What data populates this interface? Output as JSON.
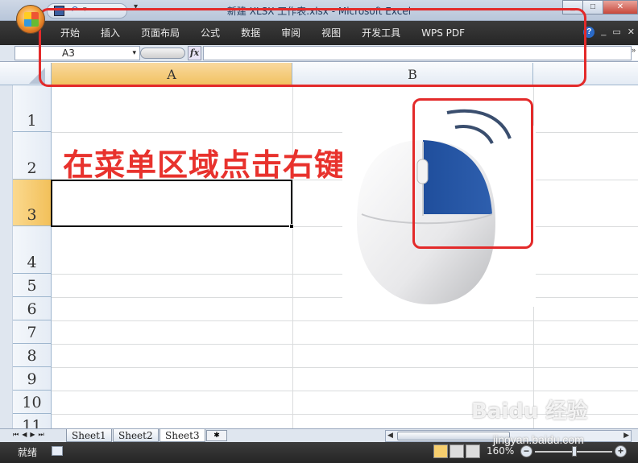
{
  "window": {
    "title": "新建 XLSX 工作表.xlsx - Microsoft Excel",
    "controls": [
      "_",
      "□",
      "✕"
    ]
  },
  "qat": {
    "undo": "↶",
    "dropdown": "▾",
    "more": "▾"
  },
  "ribbon": {
    "tabs": [
      "开始",
      "插入",
      "页面布局",
      "公式",
      "数据",
      "审阅",
      "视图",
      "开发工具",
      "WPS PDF"
    ],
    "right": {
      "help": "?",
      "min": "_",
      "restore": "▭",
      "close": "✕"
    }
  },
  "formula_bar": {
    "name_box": "A3",
    "name_box_arrow": "▾",
    "fx": "fx",
    "value": "",
    "expand": "»"
  },
  "columns": [
    {
      "label": "A",
      "selected": true
    },
    {
      "label": "B",
      "selected": false
    }
  ],
  "rows": [
    {
      "label": "1",
      "selected": false
    },
    {
      "label": "2",
      "selected": false
    },
    {
      "label": "3",
      "selected": true
    },
    {
      "label": "4",
      "selected": false
    },
    {
      "label": "5",
      "selected": false
    },
    {
      "label": "6",
      "selected": false
    },
    {
      "label": "7",
      "selected": false
    },
    {
      "label": "8",
      "selected": false
    },
    {
      "label": "9",
      "selected": false
    },
    {
      "label": "10",
      "selected": false
    },
    {
      "label": "11",
      "selected": false
    }
  ],
  "annotation": {
    "caption": "在菜单区域点击右键",
    "highlight_color": "#e32a2a"
  },
  "sheets": {
    "nav": [
      "⏮",
      "◀",
      "▶",
      "⏭"
    ],
    "tabs": [
      {
        "label": "Sheet1",
        "active": false
      },
      {
        "label": "Sheet2",
        "active": false
      },
      {
        "label": "Sheet3",
        "active": true
      }
    ],
    "new_sheet": "✱"
  },
  "status": {
    "ready": "就绪",
    "zoom": "160%",
    "zoom_minus": "−",
    "zoom_plus": "+"
  },
  "watermark": {
    "brand": "Baidu 经验",
    "url": "jingyan.baidu.com"
  },
  "colors": {
    "accent_red": "#e32a2a",
    "selected_header": "#f2c05a",
    "ribbon_bg": "#2f2f2f"
  }
}
